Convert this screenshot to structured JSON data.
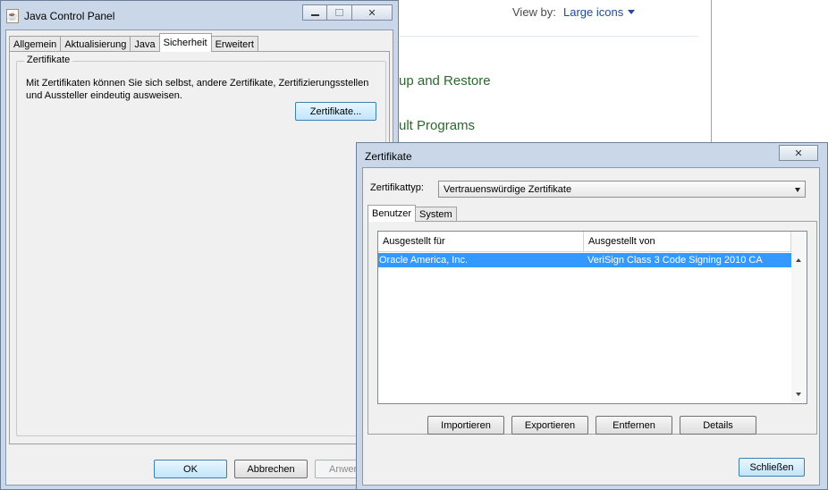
{
  "background_window": {
    "view_by_label": "View by:",
    "view_mode": "Large icons",
    "links": [
      "up and Restore",
      "ult Programs"
    ]
  },
  "java_control_panel": {
    "title": "Java Control Panel",
    "window_buttons": [
      "minimize",
      "maximize",
      "close"
    ],
    "tabs": [
      "Allgemein",
      "Aktualisierung",
      "Java",
      "Sicherheit",
      "Erweitert"
    ],
    "active_tab": "Sicherheit",
    "group_title": "Zertifikate",
    "group_text": "Mit Zertifikaten können Sie sich selbst, andere Zertifikate, Zertifizierungsstellen und Aussteller eindeutig ausweisen.",
    "certificates_button": "Zertifikate...",
    "ok_button": "OK",
    "cancel_button": "Abbrechen",
    "apply_button": "Anwen"
  },
  "cert_dialog": {
    "title": "Zertifikate",
    "cert_type_label": "Zertifikattyp:",
    "cert_type_value": "Vertrauenswürdige Zertifikate",
    "tabs": [
      "Benutzer",
      "System"
    ],
    "active_tab": "Benutzer",
    "columns": [
      "Ausgestellt für",
      "Ausgestellt von"
    ],
    "rows": [
      {
        "issued_to": "Oracle America, Inc.",
        "issued_by": "VeriSign Class 3 Code Signing 2010 CA",
        "selected": true
      }
    ],
    "buttons": {
      "import": "Importieren",
      "export": "Exportieren",
      "remove": "Entfernen",
      "details": "Details"
    },
    "close_button": "Schließen"
  },
  "colors": {
    "selection": "#3399ff",
    "titlebar": "#c9d7e8",
    "link_green": "#2a6a2a",
    "link_blue": "#1e4a9a"
  }
}
